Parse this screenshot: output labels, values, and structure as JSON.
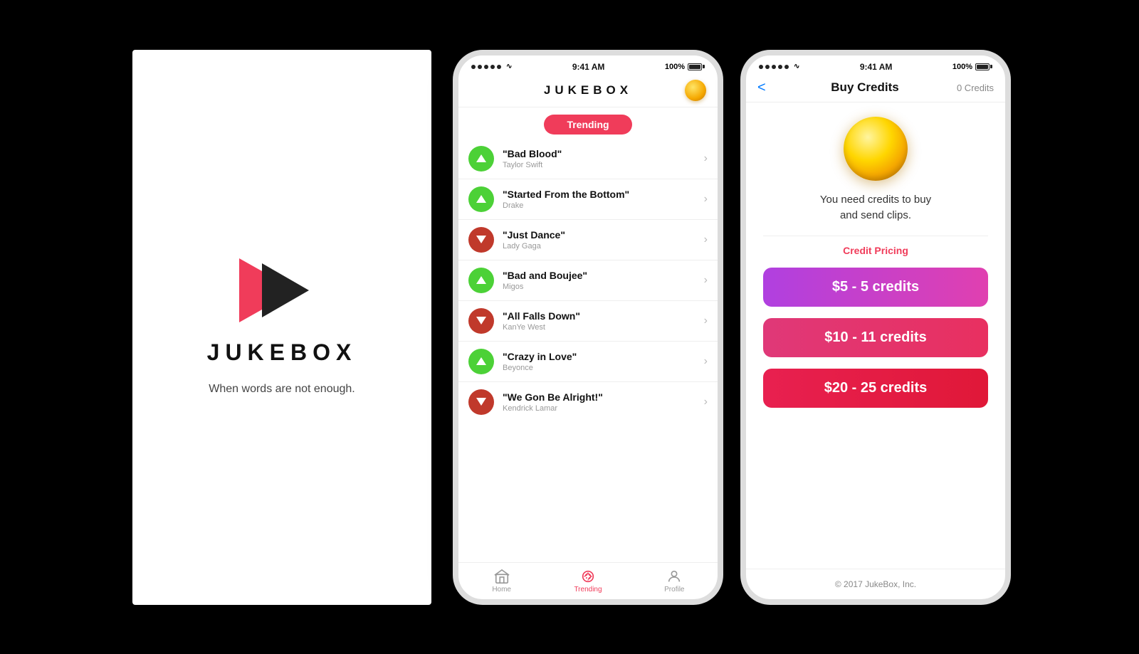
{
  "splash": {
    "title": "JUKEBOX",
    "subtitle": "When words are not enough."
  },
  "status_bar": {
    "time": "9:41 AM",
    "battery": "100%",
    "signal_dots": 5
  },
  "trending_screen": {
    "app_title": "JUKEBOX",
    "trending_label": "Trending",
    "songs": [
      {
        "title": "\"Bad Blood\"",
        "artist": "Taylor Swift",
        "trend": "up"
      },
      {
        "title": "\"Started From the Bottom\"",
        "artist": "Drake",
        "trend": "up"
      },
      {
        "title": "\"Just Dance\"",
        "artist": "Lady Gaga",
        "trend": "down"
      },
      {
        "title": "\"Bad and Boujee\"",
        "artist": "Migos",
        "trend": "up"
      },
      {
        "title": "\"All Falls Down\"",
        "artist": "KanYe West",
        "trend": "down"
      },
      {
        "title": "\"Crazy in Love\"",
        "artist": "Beyonce",
        "trend": "up"
      },
      {
        "title": "\"We Gon Be Alright!\"",
        "artist": "Kendrick Lamar",
        "trend": "down"
      }
    ],
    "tabs": [
      {
        "label": "Home",
        "active": false
      },
      {
        "label": "Trending",
        "active": true
      },
      {
        "label": "Profile",
        "active": false
      }
    ]
  },
  "buy_credits_screen": {
    "back_label": "<",
    "title": "Buy Credits",
    "credits_count": "0 Credits",
    "description": "You need credits to buy\nand send clips.",
    "credit_pricing_label": "Credit Pricing",
    "packages": [
      {
        "label": "$5 - 5 credits",
        "style": "purple"
      },
      {
        "label": "$10 - 11 credits",
        "style": "pink"
      },
      {
        "label": "$20 - 25 credits",
        "style": "red"
      }
    ],
    "footer": "© 2017 JukeBox, Inc."
  }
}
